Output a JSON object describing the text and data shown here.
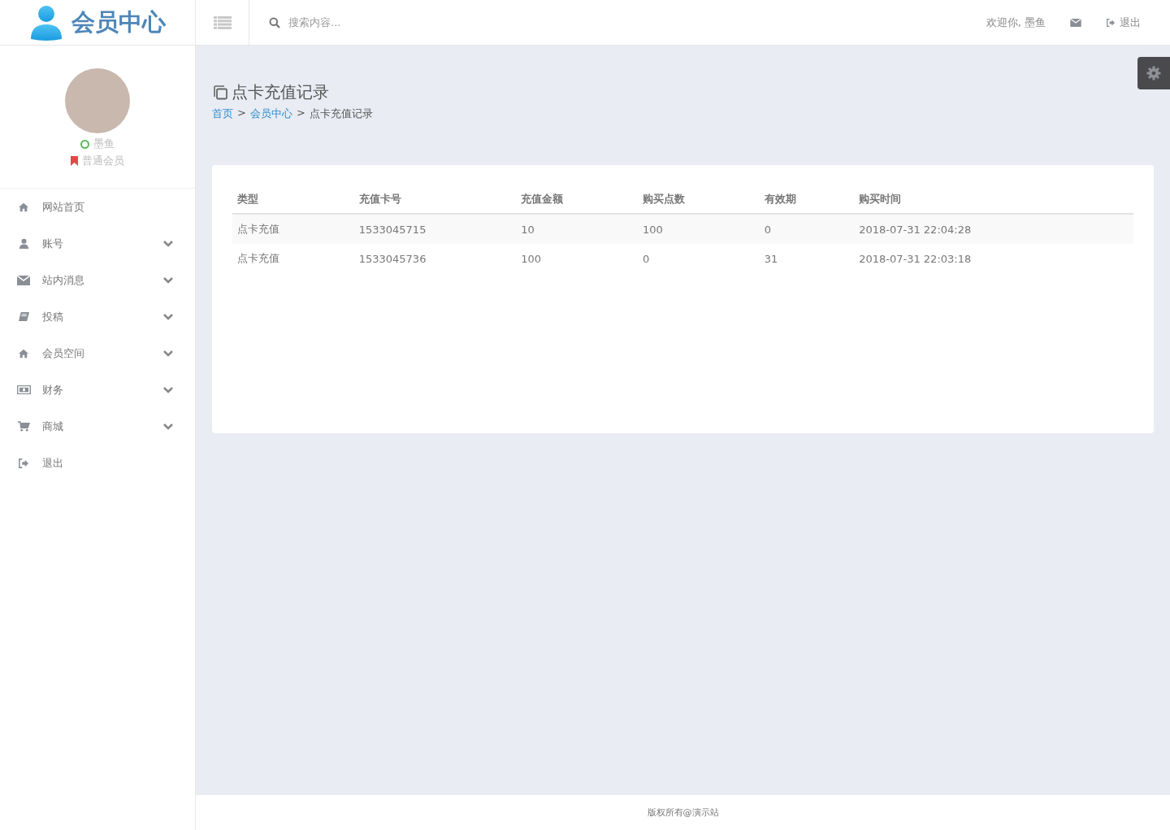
{
  "brand": {
    "title": "会员中心"
  },
  "header": {
    "search_placeholder": "搜索内容...",
    "welcome": "欢迎你, 墨鱼",
    "logout": "退出"
  },
  "profile": {
    "name": "墨鱼",
    "level": "普通会员"
  },
  "sidebar": {
    "items": [
      {
        "label": "网站首页",
        "has_submenu": false
      },
      {
        "label": "账号",
        "has_submenu": true
      },
      {
        "label": "站内消息",
        "has_submenu": true
      },
      {
        "label": "投稿",
        "has_submenu": true
      },
      {
        "label": "会员空间",
        "has_submenu": true
      },
      {
        "label": "财务",
        "has_submenu": true
      },
      {
        "label": "商城",
        "has_submenu": true
      },
      {
        "label": "退出",
        "has_submenu": false
      }
    ]
  },
  "page": {
    "title": "点卡充值记录",
    "breadcrumb": [
      "首页",
      "会员中心",
      "点卡充值记录"
    ],
    "separator": ">"
  },
  "table": {
    "columns": [
      "类型",
      "充值卡号",
      "充值金额",
      "购买点数",
      "有效期",
      "购买时间"
    ],
    "rows": [
      [
        "点卡充值",
        "1533045715",
        "10",
        "100",
        "0",
        "2018-07-31 22:04:28"
      ],
      [
        "点卡充值",
        "1533045736",
        "100",
        "0",
        "31",
        "2018-07-31 22:03:18"
      ]
    ]
  },
  "footer": {
    "text": "版权所有@演示站"
  }
}
